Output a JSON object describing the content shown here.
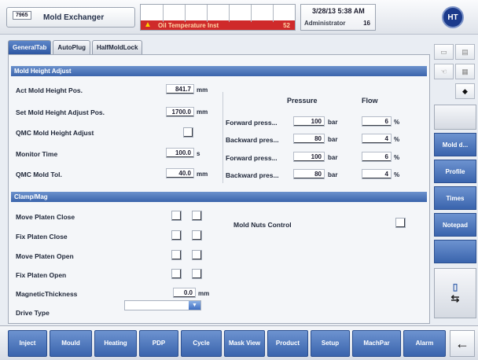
{
  "header": {
    "machine_number": "7965",
    "machine_title": "Mold Exchanger",
    "alarm_text": "Oil Temperature Inst",
    "alarm_count": "52",
    "datetime": "3/28/13 5:38 AM",
    "user": "Administrator",
    "user_level": "16",
    "logo_text": "HT"
  },
  "tabs": [
    "GeneralTab",
    "AutoPlug",
    "HalfMoldLock"
  ],
  "mold_height": {
    "title": "Mold Height Adjust",
    "rows": [
      {
        "label": "Act Mold Height Pos.",
        "value": "841.7",
        "unit": "mm"
      },
      {
        "label": "Set Mold Height Adjust Pos.",
        "value": "1700.0",
        "unit": "mm"
      },
      {
        "label": "QMC Mold Height Adjust",
        "value": "",
        "unit": ""
      },
      {
        "label": "Monitor Time",
        "value": "100.0",
        "unit": "s"
      },
      {
        "label": "QMC Mold Tol.",
        "value": "40.0",
        "unit": "mm"
      }
    ],
    "pressure_header": "Pressure",
    "flow_header": "Flow",
    "press_rows": [
      {
        "label": "Forward press...",
        "pressure": "100",
        "punit": "bar",
        "flow": "6",
        "funit": "%"
      },
      {
        "label": "Backward pres...",
        "pressure": "80",
        "punit": "bar",
        "flow": "4",
        "funit": "%"
      },
      {
        "label": "Forward press...",
        "pressure": "100",
        "punit": "bar",
        "flow": "6",
        "funit": "%"
      },
      {
        "label": "Backward pres...",
        "pressure": "80",
        "punit": "bar",
        "flow": "4",
        "funit": "%"
      }
    ]
  },
  "clamp": {
    "title": "Clamp/Mag",
    "rows": [
      {
        "label": "Move Platen Close"
      },
      {
        "label": "Fix Platen Close"
      },
      {
        "label": "Move Platen Open"
      },
      {
        "label": "Fix  Platen Open"
      }
    ],
    "thickness_label": "MagneticThickness",
    "thickness_value": "0.0",
    "thickness_unit": "mm",
    "drive_label": "Drive Type",
    "drive_value": "",
    "mold_nuts_label": "Mold Nuts Control"
  },
  "side": {
    "buttons": [
      "Mold d...",
      "Profile",
      "Times",
      "Notepad"
    ]
  },
  "nav": [
    "Inject",
    "Mould",
    "Heating",
    "PDP",
    "Cycle",
    "Mask View",
    "Product",
    "Setup",
    "MachPar",
    "Alarm"
  ],
  "colors": {
    "accent": "#3a64ad",
    "alarm": "#cf2a2a",
    "tab_active": "#2e57a3"
  }
}
